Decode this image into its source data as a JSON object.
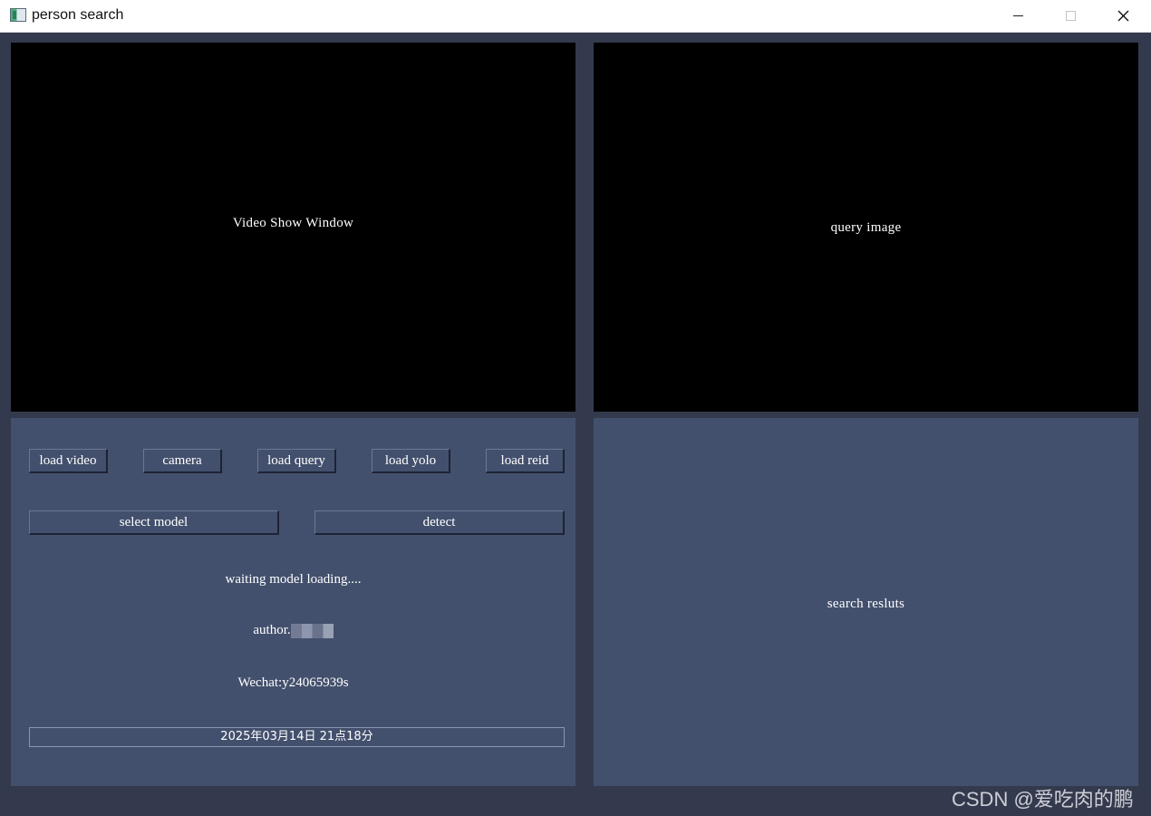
{
  "window": {
    "title": "person search",
    "minimize_glyph": "—",
    "close_glyph": "✕"
  },
  "video_panel": {
    "label": "Video Show Window"
  },
  "query_panel": {
    "label": "query image"
  },
  "controls": {
    "load_video": "load video",
    "camera": "camera",
    "load_query": "load query",
    "load_yolo": "load yolo",
    "load_reid": "load reid",
    "select_model": "select model",
    "detect": "detect"
  },
  "status": {
    "message": "waiting model loading....",
    "author_label": "author.",
    "wechat": "Wechat:y24065939s",
    "datetime": "2025年03月14日 21点18分"
  },
  "results_panel": {
    "label": "search resluts"
  },
  "watermark": "CSDN @爱吃肉的鹏",
  "colors": {
    "background": "#343a4d",
    "panel": "#43506d",
    "display": "#000000",
    "text": "#ffffff"
  }
}
